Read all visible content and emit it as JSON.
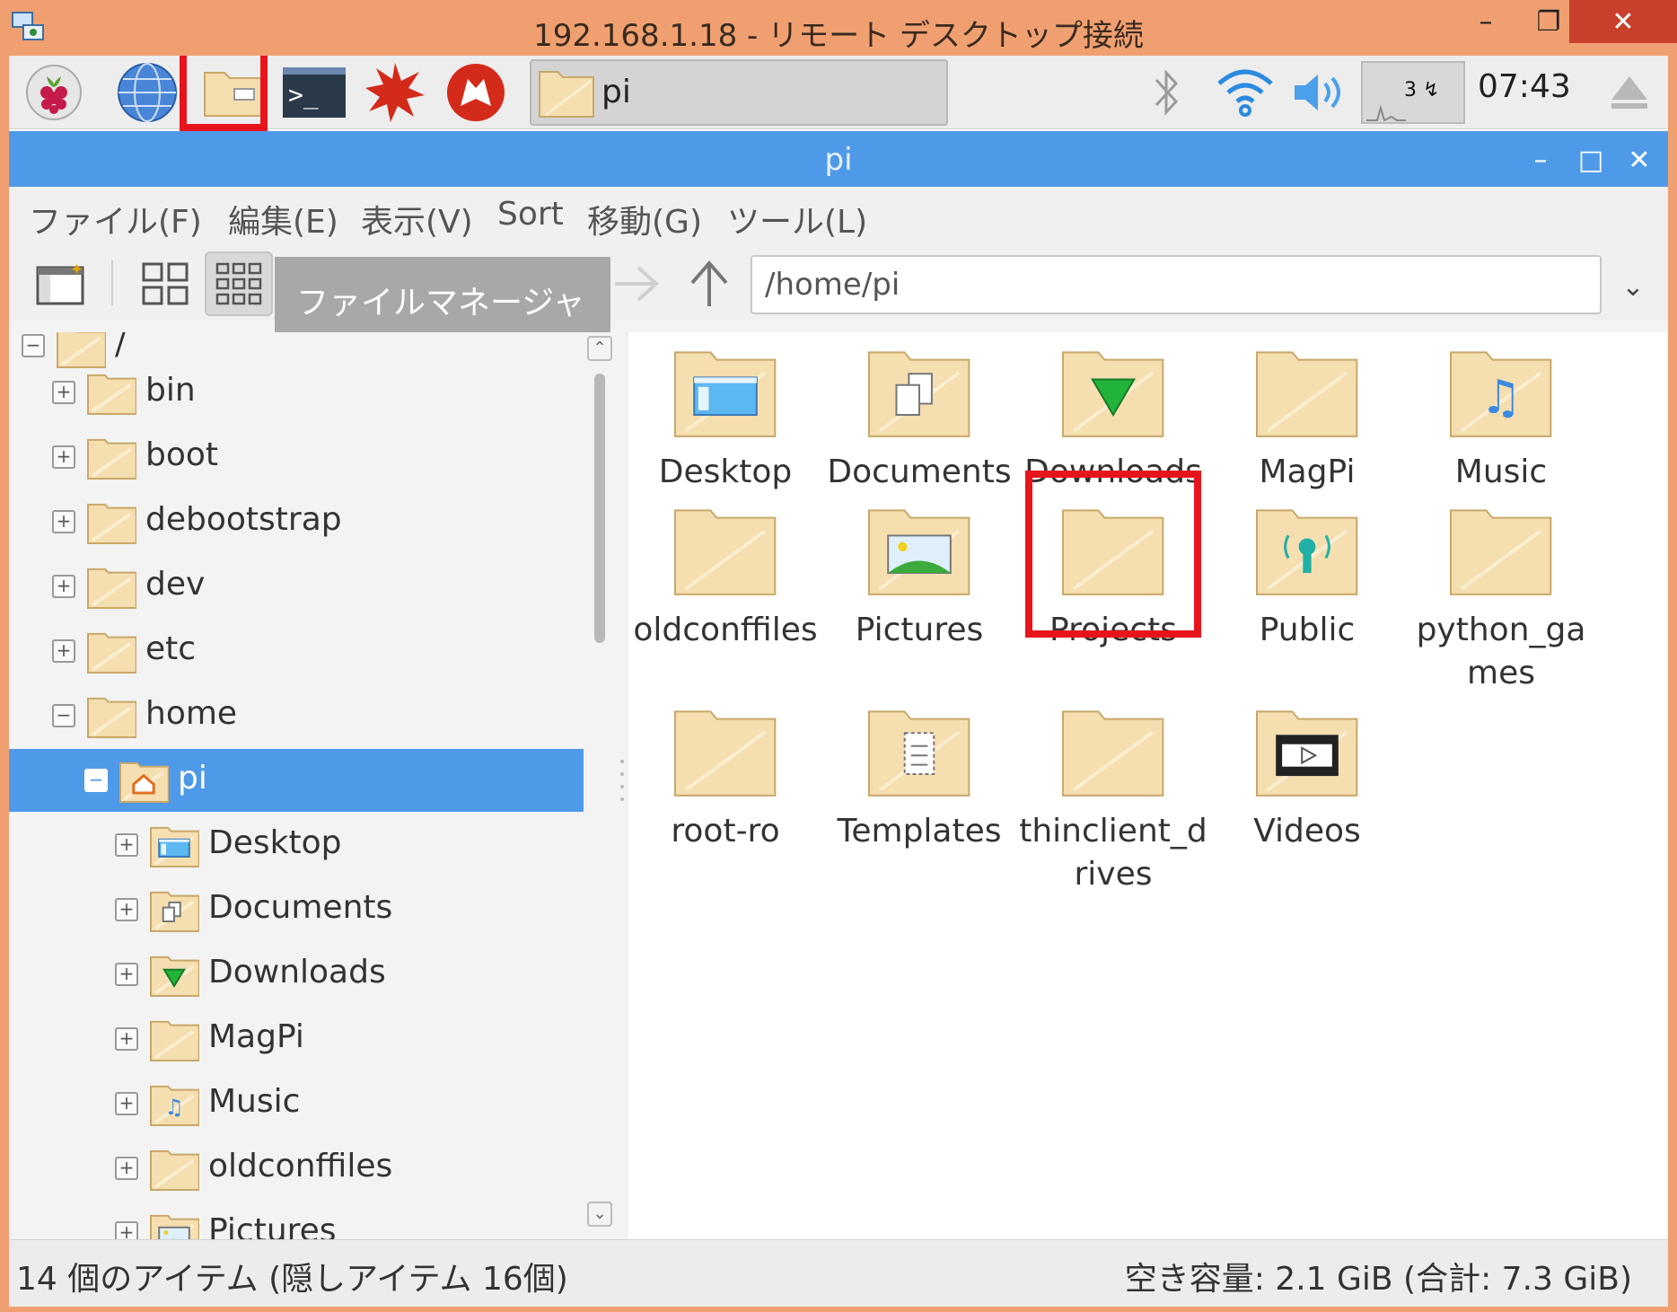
{
  "rdp": {
    "title": "192.168.1.18 - リモート デスクトップ接続",
    "minimize": "–",
    "maximize": "❐",
    "close": "✕"
  },
  "taskbar": {
    "launchers": [
      {
        "icon": "raspberry-menu-icon"
      },
      {
        "icon": "web-browser-icon"
      },
      {
        "icon": "file-manager-icon"
      },
      {
        "icon": "terminal-icon"
      },
      {
        "icon": "mathematica-icon"
      },
      {
        "icon": "wolfram-icon"
      }
    ],
    "terminal_prompt": ">_",
    "window_button_label": "pi",
    "cpu_text": "3 ↯",
    "clock": "07:43"
  },
  "file_manager": {
    "title": "pi",
    "minimize": "–",
    "maximize": "□",
    "close": "✕",
    "tooltip": "ファイルマネージャ",
    "menus": [
      "ファイル(F)",
      "編集(E)",
      "表示(V)",
      "Sort",
      "移動(G)",
      "ツール(L)"
    ],
    "path": "/home/pi",
    "tree": [
      {
        "label": "/",
        "expander": "−",
        "level": 0,
        "icon": "folder"
      },
      {
        "label": "bin",
        "expander": "+",
        "level": 1,
        "icon": "folder"
      },
      {
        "label": "boot",
        "expander": "+",
        "level": 1,
        "icon": "folder"
      },
      {
        "label": "debootstrap",
        "expander": "+",
        "level": 1,
        "icon": "folder"
      },
      {
        "label": "dev",
        "expander": "+",
        "level": 1,
        "icon": "folder"
      },
      {
        "label": "etc",
        "expander": "+",
        "level": 1,
        "icon": "folder"
      },
      {
        "label": "home",
        "expander": "−",
        "level": 1,
        "icon": "folder"
      },
      {
        "label": "pi",
        "expander": "−",
        "level": 2,
        "icon": "home",
        "selected": true
      },
      {
        "label": "Desktop",
        "expander": "+",
        "level": 3,
        "icon": "desktop"
      },
      {
        "label": "Documents",
        "expander": "+",
        "level": 3,
        "icon": "documents"
      },
      {
        "label": "Downloads",
        "expander": "+",
        "level": 3,
        "icon": "downloads"
      },
      {
        "label": "MagPi",
        "expander": "+",
        "level": 3,
        "icon": "folder"
      },
      {
        "label": "Music",
        "expander": "+",
        "level": 3,
        "icon": "music"
      },
      {
        "label": "oldconffiles",
        "expander": "+",
        "level": 3,
        "icon": "folder"
      },
      {
        "label": "Pictures",
        "expander": "+",
        "level": 3,
        "icon": "pictures"
      }
    ],
    "icons": [
      {
        "label": "Desktop",
        "icon": "desktop"
      },
      {
        "label": "Documents",
        "icon": "documents"
      },
      {
        "label": "Downloads",
        "icon": "downloads"
      },
      {
        "label": "MagPi",
        "icon": "folder"
      },
      {
        "label": "Music",
        "icon": "music"
      },
      {
        "label": "oldconffiles",
        "icon": "folder"
      },
      {
        "label": "Pictures",
        "icon": "pictures"
      },
      {
        "label": "Projects",
        "icon": "folder"
      },
      {
        "label": "Public",
        "icon": "public"
      },
      {
        "label": "python_games",
        "icon": "folder"
      },
      {
        "label": "root-ro",
        "icon": "folder"
      },
      {
        "label": "Templates",
        "icon": "templates"
      },
      {
        "label": "thinclient_drives",
        "icon": "folder"
      },
      {
        "label": "Videos",
        "icon": "videos"
      }
    ],
    "status_left": "14 個のアイテム (隠しアイテム 16個)",
    "status_right": "空き容量: 2.1 GiB (合計: 7.3 GiB)"
  },
  "colors": {
    "rdp_titlebar": "#f0a070",
    "fm_titlebar": "#4f9ae8",
    "highlight_box": "#e8141c",
    "folder_fill": "#f5deb0"
  }
}
